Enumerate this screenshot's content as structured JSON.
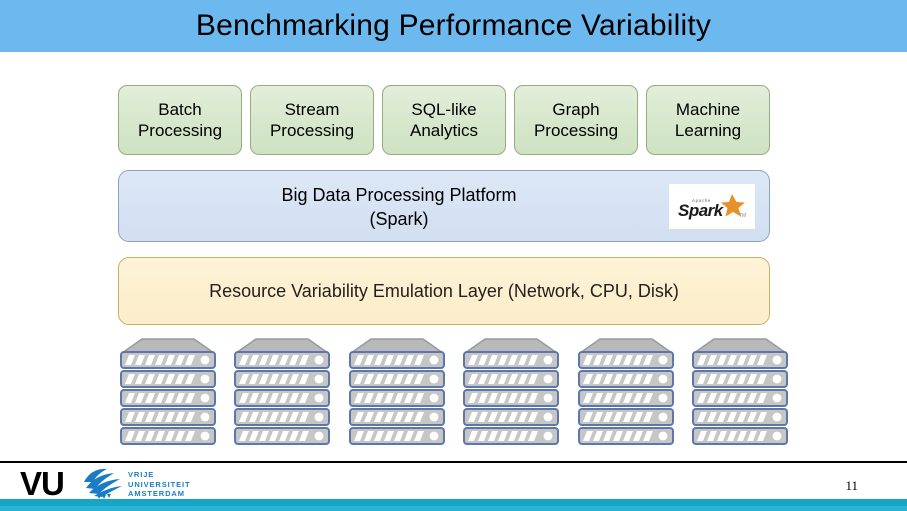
{
  "slide": {
    "title": "Benchmarking Performance Variability",
    "page_number": "11",
    "colors": {
      "title_band": "#6cb9ef",
      "green_box": "#d6e7cb",
      "green_border": "#93ad7e",
      "blue_band": "#d6e2f3",
      "blue_border": "#8aa3c4",
      "yellow_band": "#fcefcd",
      "yellow_border": "#c9ae68",
      "rack_body": "#c6c6c6",
      "rack_border": "#5b77ab",
      "footer_bar": "#16a4c8",
      "vu_blue": "#1a7cc4",
      "spark_orange": "#e8902a"
    }
  },
  "workload_boxes": [
    {
      "line1": "Batch",
      "line2": "Processing"
    },
    {
      "line1": "Stream",
      "line2": "Processing"
    },
    {
      "line1": "SQL-like",
      "line2": "Analytics"
    },
    {
      "line1": "Graph",
      "line2": "Processing"
    },
    {
      "line1": "Machine",
      "line2": "Learning"
    }
  ],
  "platform_layer": {
    "line1": "Big Data Processing Platform",
    "line2": "(Spark)",
    "logo": {
      "icon": "spark-logo-icon",
      "small_text": "Apache",
      "wordmark": "Spark"
    }
  },
  "emulation_layer": {
    "label": "Resource Variability Emulation Layer (Network, CPU, Disk)"
  },
  "hardware_layer": {
    "icon": "server-rack-icon",
    "rack_count": 6,
    "units_per_rack": 5
  },
  "footer": {
    "logo": {
      "mark": "VU",
      "bird_icon": "vu-griffin-icon",
      "line1": "VRIJE",
      "line2": "UNIVERSITEIT",
      "line3": "AMSTERDAM"
    }
  }
}
